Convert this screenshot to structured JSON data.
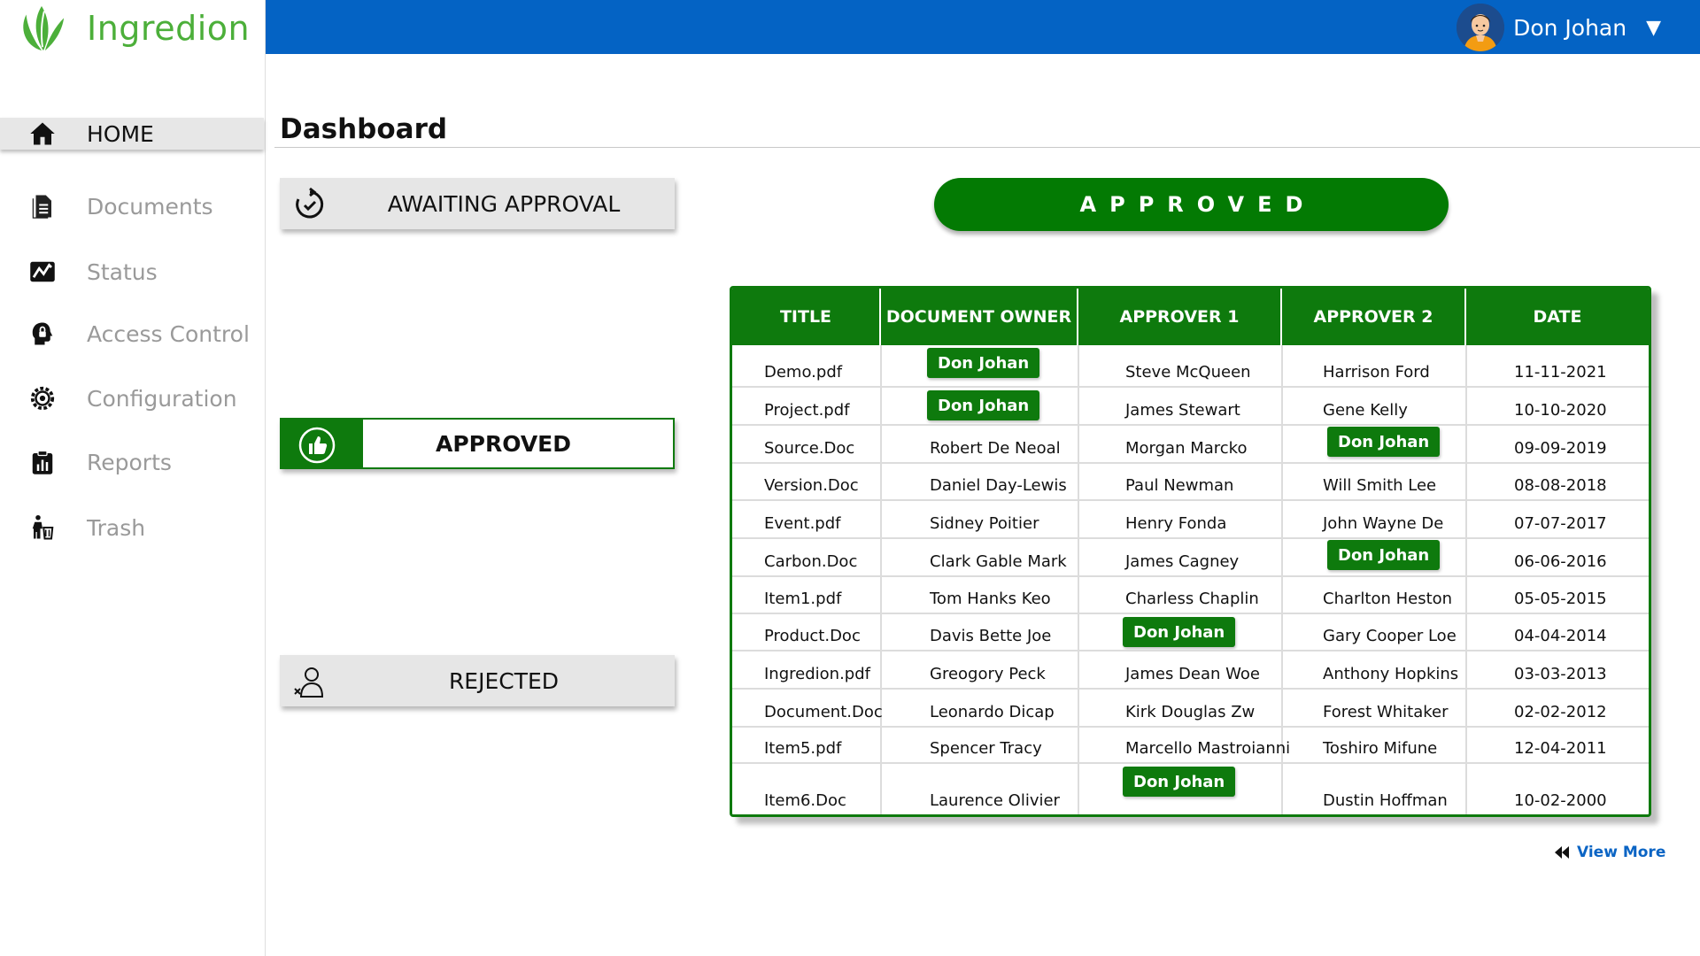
{
  "brand": {
    "name": "Ingredion"
  },
  "user": {
    "name": "Don Johan",
    "caret": "▼"
  },
  "sidebar": {
    "items": [
      {
        "label": "HOME",
        "icon": "home-icon",
        "active": true
      },
      {
        "label": "Documents",
        "icon": "document-icon"
      },
      {
        "label": "Status",
        "icon": "chart-line-icon"
      },
      {
        "label": "Access Control",
        "icon": "head-lock-icon"
      },
      {
        "label": "Configuration",
        "icon": "gear-icon"
      },
      {
        "label": "Reports",
        "icon": "clipboard-chart-icon"
      },
      {
        "label": "Trash",
        "icon": "trash-person-icon"
      }
    ]
  },
  "page": {
    "title": "Dashboard"
  },
  "filters": {
    "awaiting": {
      "label": "AWAITING APPROVAL",
      "icon": "refresh-check-icon"
    },
    "approved": {
      "label": "APPROVED",
      "icon": "thumbs-up-icon"
    },
    "rejected": {
      "label": "REJECTED",
      "icon": "user-x-icon"
    }
  },
  "banner": {
    "label": "APPROVED"
  },
  "table": {
    "headers": [
      "TITLE",
      "DOCUMENT OWNER",
      "APPROVER 1",
      "APPROVER 2",
      "DATE"
    ],
    "rows": [
      [
        "Demo.pdf",
        "Don Johan",
        "Steve McQueen",
        "Harrison Ford",
        "11-11-2021"
      ],
      [
        "Project.pdf",
        "Don Johan",
        "James Stewart",
        "Gene Kelly",
        "10-10-2020"
      ],
      [
        "Source.Doc",
        "Robert De Neoal",
        "Morgan Marcko",
        "Don Johan",
        "09-09-2019"
      ],
      [
        "Version.Doc",
        "Daniel Day-Lewis",
        "Paul Newman",
        "Will Smith Lee",
        "08-08-2018"
      ],
      [
        "Event.pdf",
        "Sidney Poitier",
        "Henry Fonda",
        "John Wayne De",
        "07-07-2017"
      ],
      [
        "Carbon.Doc",
        "Clark Gable Mark",
        "James Cagney",
        "Don Johan",
        "06-06-2016"
      ],
      [
        "Item1.pdf",
        "Tom Hanks Keo",
        "Charless Chaplin",
        "Charlton Heston",
        "05-05-2015"
      ],
      [
        "Product.Doc",
        "Davis Bette Joe",
        "Don Johan",
        "Gary Cooper Loe",
        "04-04-2014"
      ],
      [
        "Ingredion.pdf",
        "Greogory Peck",
        "James Dean Woe",
        "Anthony Hopkins",
        "03-03-2013"
      ],
      [
        "Document.Doc",
        "Leonardo Dicap",
        "Kirk Douglas Zw",
        "Forest Whitaker",
        "02-02-2012"
      ],
      [
        "Item5.pdf",
        "Spencer Tracy",
        "Marcello Mastroianni",
        "Toshiro Mifune",
        "12-04-2011"
      ],
      [
        "Item6.Doc",
        "Laurence Olivier",
        "Don Johan",
        "Dustin Hoffman",
        "10-02-2000"
      ]
    ],
    "highlight_name": "Don Johan"
  },
  "view_more": {
    "label": "View More",
    "icon": "rewind-icon"
  },
  "colors": {
    "green": "#0e7a0d",
    "blue": "#0463c4",
    "brand_green": "#4caf3a",
    "link": "#0a64c4"
  }
}
